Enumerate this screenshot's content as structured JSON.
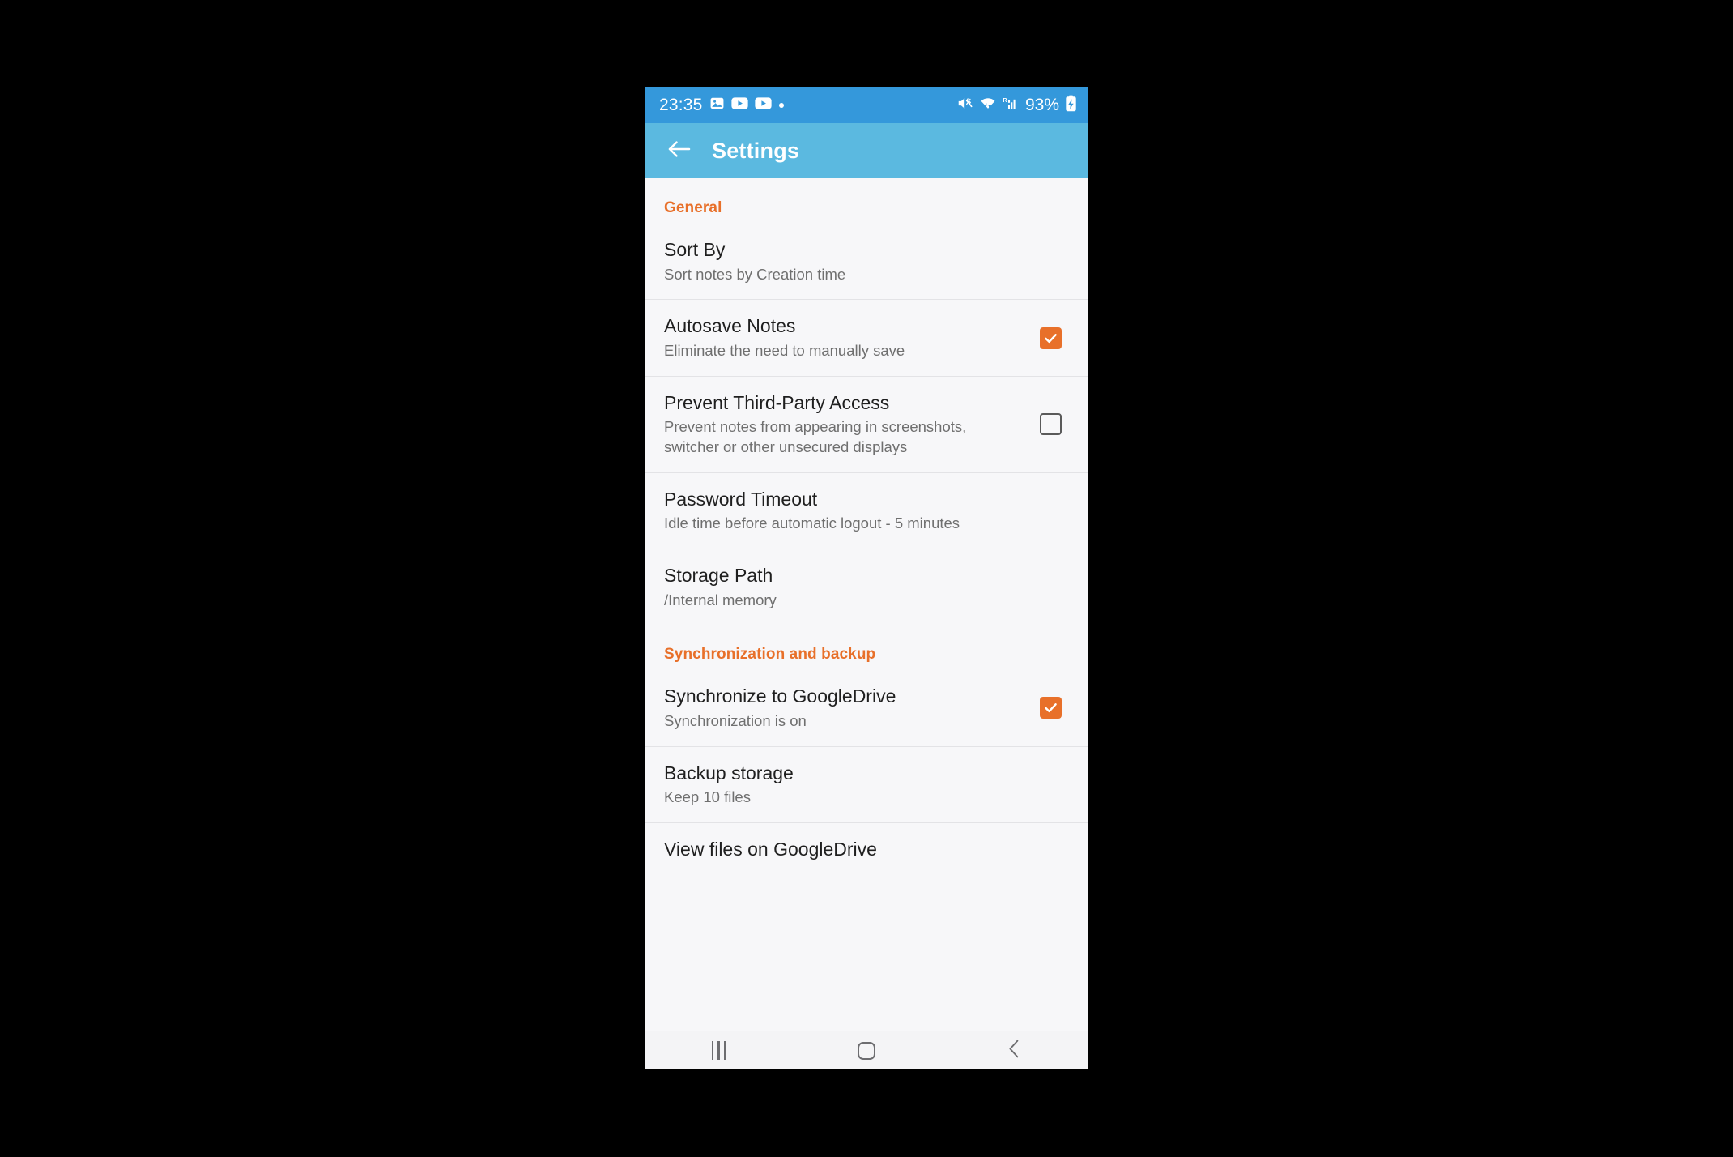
{
  "status_bar": {
    "time": "23:35",
    "battery_percent": "93%",
    "left_icons": [
      "photo-icon",
      "video-play-icon",
      "video-play-icon",
      "dot-indicator-icon"
    ],
    "right_icons": [
      "mute-vibrate-icon",
      "wifi-icon",
      "signal-roaming-icon",
      "battery-charging-icon"
    ],
    "background_color": "#3498db"
  },
  "app_bar": {
    "title": "Settings",
    "back_icon": "arrow-left-icon",
    "background_color": "#5bb9e0"
  },
  "theme": {
    "accent_orange": "#e8702a",
    "list_background": "#f7f7f9",
    "divider": "#e3e3e6"
  },
  "sections": [
    {
      "header": "General",
      "rows": [
        {
          "title": "Sort By",
          "subtitle": "Sort notes by Creation time",
          "control": "none",
          "name": "row-sort-by"
        },
        {
          "title": "Autosave Notes",
          "subtitle": "Eliminate the need to manually save",
          "control": "checkbox",
          "checked": true,
          "name": "row-autosave-notes"
        },
        {
          "title": "Prevent Third-Party Access",
          "subtitle": "Prevent notes from appearing in screenshots, switcher or other unsecured displays",
          "control": "checkbox",
          "checked": false,
          "name": "row-prevent-third-party-access"
        },
        {
          "title": "Password Timeout",
          "subtitle": "Idle time before automatic logout - 5 minutes",
          "control": "none",
          "name": "row-password-timeout"
        },
        {
          "title": "Storage Path",
          "subtitle": "/Internal memory",
          "control": "none",
          "name": "row-storage-path"
        }
      ]
    },
    {
      "header": "Synchronization and backup",
      "rows": [
        {
          "title": "Synchronize to GoogleDrive",
          "subtitle": "Synchronization is on",
          "control": "checkbox",
          "checked": true,
          "name": "row-synchronize-to-googledrive"
        },
        {
          "title": "Backup storage",
          "subtitle": "Keep 10 files",
          "control": "none",
          "name": "row-backup-storage"
        },
        {
          "title": "View files on GoogleDrive",
          "subtitle": "",
          "control": "none",
          "name": "row-view-files-on-googledrive"
        }
      ]
    }
  ],
  "nav_bar": {
    "recents_icon": "recents-icon",
    "home_icon": "home-icon",
    "back_icon": "back-chevron-icon"
  }
}
